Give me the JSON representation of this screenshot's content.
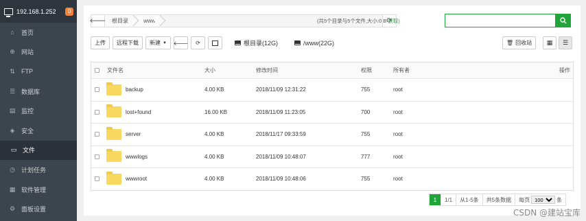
{
  "sidebar": {
    "server_ip": "192.168.1.252",
    "notify_count": "0",
    "items": [
      {
        "label": "首页",
        "icon": "home-icon",
        "glyph": "⌂"
      },
      {
        "label": "网站",
        "icon": "globe-icon",
        "glyph": "⊕"
      },
      {
        "label": "FTP",
        "icon": "ftp-icon",
        "glyph": "⇅"
      },
      {
        "label": "数据库",
        "icon": "database-icon",
        "glyph": "☰"
      },
      {
        "label": "监控",
        "icon": "monitor-icon",
        "glyph": "▤"
      },
      {
        "label": "安全",
        "icon": "shield-icon",
        "glyph": "◈"
      },
      {
        "label": "文件",
        "icon": "folder-icon",
        "glyph": "▭"
      },
      {
        "label": "计划任务",
        "icon": "clock-icon",
        "glyph": "◷"
      },
      {
        "label": "软件管理",
        "icon": "grid-icon",
        "glyph": "▦"
      },
      {
        "label": "面板设置",
        "icon": "gear-icon",
        "glyph": "⚙"
      }
    ],
    "active_index": 6
  },
  "path": {
    "crumbs": [
      "根目录",
      "www"
    ],
    "dir_info": "(共5个目录与5个文件,大小:0 B",
    "get_size": "获取)"
  },
  "search": {
    "placeholder": ""
  },
  "toolbar": {
    "upload": "上传",
    "remote_download": "远程下载",
    "new": "新建",
    "root_disk": "根目录(12G)",
    "www_disk": "/www(22G)",
    "recycle_bin": "回收站"
  },
  "table": {
    "headers": {
      "name": "文件名",
      "size": "大小",
      "mtime": "修改时间",
      "perm": "权限",
      "owner": "所有者",
      "op": "操作"
    },
    "rows": [
      {
        "name": "backup",
        "size": "4.00 KB",
        "mtime": "2018/11/09 12:31:22",
        "perm": "755",
        "owner": "root"
      },
      {
        "name": "lost+found",
        "size": "16.00 KB",
        "mtime": "2018/11/09 11:23:05",
        "perm": "700",
        "owner": "root"
      },
      {
        "name": "server",
        "size": "4.00 KB",
        "mtime": "2018/11/17 09:33:59",
        "perm": "755",
        "owner": "root"
      },
      {
        "name": "wwwlogs",
        "size": "4.00 KB",
        "mtime": "2018/11/09 10:48:07",
        "perm": "777",
        "owner": "root"
      },
      {
        "name": "wwwroot",
        "size": "4.00 KB",
        "mtime": "2018/11/09 10:48:06",
        "perm": "755",
        "owner": "root"
      }
    ]
  },
  "pager": {
    "current": "1",
    "pages": "1/1",
    "range": "从1-5条",
    "total": "共5条数据",
    "per_page_label": "每页",
    "per_page_value": "100",
    "unit": "条"
  },
  "watermark": "CSDN @建站宝库",
  "colors": {
    "accent": "#20a53a",
    "sidebar": "#3c444d",
    "badge": "#f0843c",
    "folder": "#f9d862"
  }
}
